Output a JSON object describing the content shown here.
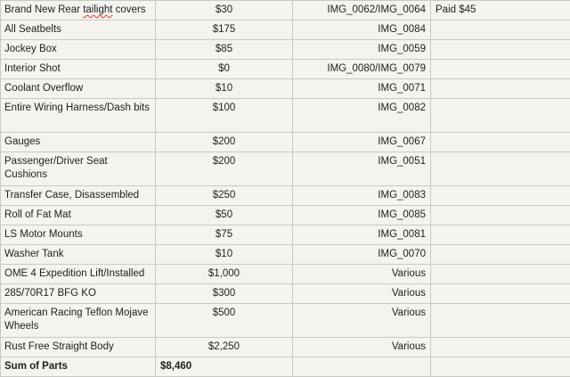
{
  "rows": [
    {
      "item_pre": "Brand New Rear ",
      "item_flag": "tailight",
      "item_post": " covers",
      "price": "$30",
      "images": "IMG_0062/IMG_0064",
      "note": "Paid $45",
      "tall": false
    },
    {
      "item": "All Seatbelts",
      "price": "$175",
      "images": "IMG_0084",
      "note": "",
      "tall": false
    },
    {
      "item": "Jockey Box",
      "price": "$85",
      "images": "IMG_0059",
      "note": "",
      "tall": false
    },
    {
      "item": "Interior Shot",
      "price": "$0",
      "images": "IMG_0080/IMG_0079",
      "note": "",
      "tall": false
    },
    {
      "item": "Coolant Overflow",
      "price": "$10",
      "images": "IMG_0071",
      "note": "",
      "tall": false
    },
    {
      "item": "Entire Wiring Harness/Dash bits",
      "price": "$100",
      "images": "IMG_0082",
      "note": "",
      "tall": true
    },
    {
      "item": "Gauges",
      "price": "$200",
      "images": "IMG_0067",
      "note": "",
      "tall": false
    },
    {
      "item": "Passenger/Driver Seat Cushions",
      "price": "$200",
      "images": "IMG_0051",
      "note": "",
      "tall": true
    },
    {
      "item": "Transfer Case, Disassembled",
      "price": "$250",
      "images": "IMG_0083",
      "note": "",
      "tall": false
    },
    {
      "item": "Roll of Fat Mat",
      "price": "$50",
      "images": "IMG_0085",
      "note": "",
      "tall": false
    },
    {
      "item": "LS Motor Mounts",
      "price": "$75",
      "images": "IMG_0081",
      "note": "",
      "tall": false
    },
    {
      "item": "Washer Tank",
      "price": "$10",
      "images": "IMG_0070",
      "note": "",
      "tall": false
    },
    {
      "item": "OME 4 Expedition Lift/Installed",
      "price": "$1,000",
      "images": "Various",
      "note": "",
      "tall": false
    },
    {
      "item": "285/70R17 BFG KO",
      "price": "$300",
      "images": "Various",
      "note": "",
      "tall": false
    },
    {
      "item": "American Racing Teflon Mojave Wheels",
      "price": "$500",
      "images": "Various",
      "note": "",
      "tall": true
    },
    {
      "item": "Rust Free Straight Body",
      "price": "$2,250",
      "images": "Various",
      "note": "",
      "tall": false
    }
  ],
  "total": {
    "label": "Sum of Parts",
    "value": "$8,460"
  }
}
